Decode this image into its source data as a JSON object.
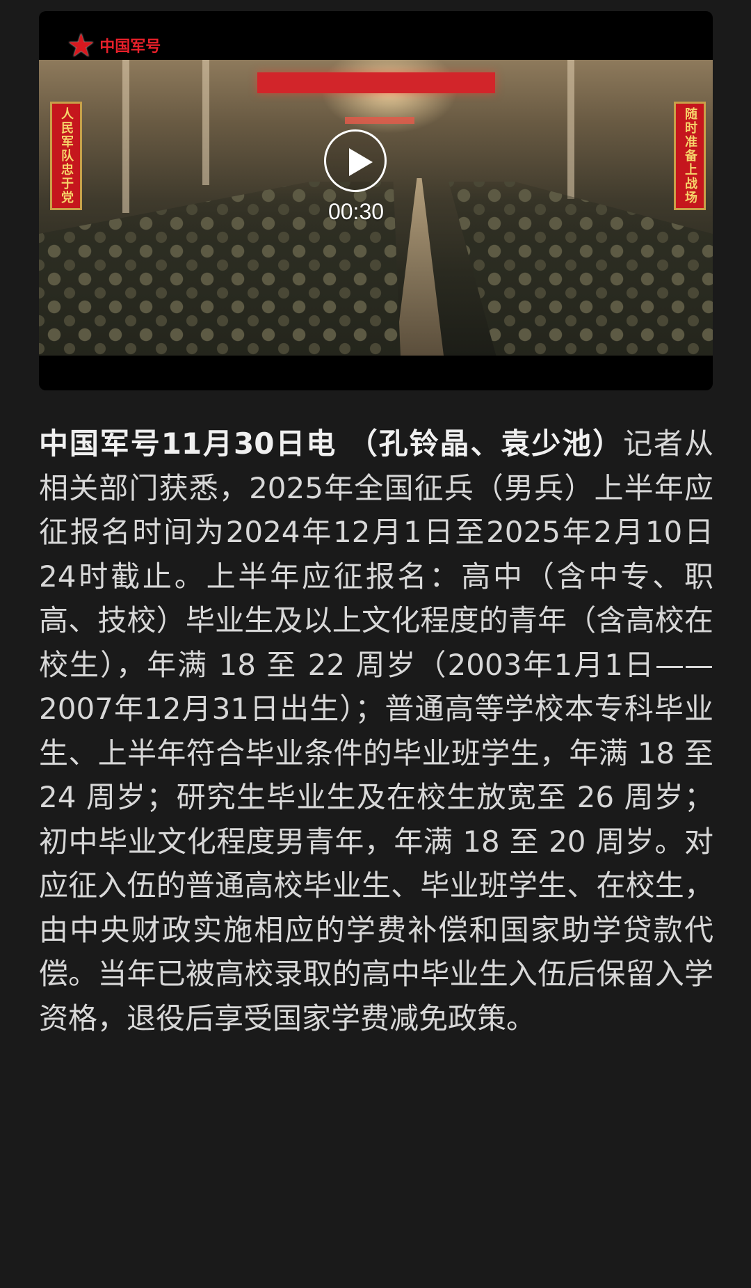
{
  "video": {
    "logo_text": "中国军号",
    "duration": "00:30",
    "banner_left": "人民军队忠于党",
    "banner_right": "随时准备上战场"
  },
  "article": {
    "lead": "中国军号11月30日电 （孔铃晶、袁少池）",
    "body": "记者从相关部门获悉，2025年全国征兵（男兵）上半年应征报名时间为2024年12月1日至2025年2月10日24时截止。上半年应征报名：高中（含中专、职高、技校）毕业生及以上文化程度的青年（含高校在校生），年满 18 至 22 周岁（2003年1月1日——2007年12月31日出生）；普通高等学校本专科毕业生、上半年符合毕业条件的毕业班学生，年满 18 至 24 周岁；研究生毕业生及在校生放宽至 26 周岁；初中毕业文化程度男青年，年满 18 至 20 周岁。对应征入伍的普通高校毕业生、毕业班学生、在校生，由中央财政实施相应的学费补偿和国家助学贷款代偿。当年已被高校录取的高中毕业生入伍后保留入学资格，退役后享受国家学费减免政策。"
  }
}
